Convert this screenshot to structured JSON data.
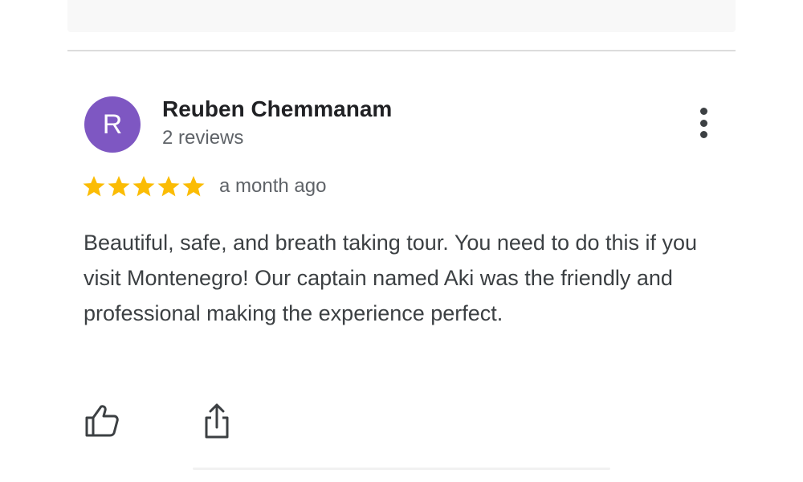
{
  "reviewer": {
    "initial": "R",
    "name": "Reuben Chemmanam",
    "review_count": "2 reviews",
    "avatar_color": "#7e57c2"
  },
  "review": {
    "rating": 5,
    "rating_max": 5,
    "star_color": "#fbbc04",
    "date": "a month ago",
    "text": "Beautiful, safe, and breath taking tour. You need to do this if you visit Montenegro! Our captain named Aki was the friendly and professional making the experience perfect."
  },
  "icons": {
    "menu": "more-vert-icon",
    "like": "thumbs-up-icon",
    "share": "share-icon",
    "star": "star-icon"
  }
}
